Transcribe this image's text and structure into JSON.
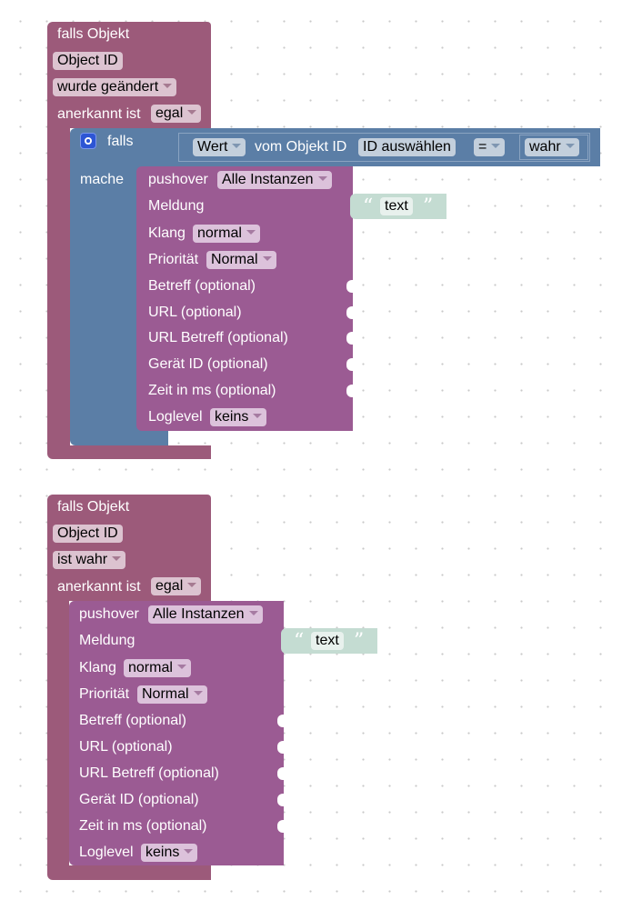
{
  "blocks": [
    {
      "trigger": {
        "title": "falls Objekt",
        "object_id": "Object ID",
        "mode": "wurde geändert",
        "ack_label": "anerkannt ist",
        "ack_value": "egal"
      },
      "if_block": {
        "icon": "gear-icon",
        "if_label": "falls",
        "do_label": "mache",
        "condition": {
          "value_dropdown": "Wert",
          "of_object_label": "vom Objekt ID",
          "object_select": "ID auswählen",
          "operator": "=",
          "compare_value": "wahr"
        }
      },
      "pushover": {
        "label": "pushover",
        "instance": "Alle Instanzen",
        "message_label": "Meldung",
        "message_text": "text",
        "sound_label": "Klang",
        "sound_value": "normal",
        "priority_label": "Priorität",
        "priority_value": "Normal",
        "subject_label": "Betreff (optional)",
        "url_label": "URL (optional)",
        "url_title_label": "URL Betreff (optional)",
        "device_label": "Gerät ID (optional)",
        "time_label": "Zeit in ms (optional)",
        "loglevel_label": "Loglevel",
        "loglevel_value": "keins"
      }
    },
    {
      "trigger": {
        "title": "falls Objekt",
        "object_id": "Object ID",
        "mode": "ist wahr",
        "ack_label": "anerkannt ist",
        "ack_value": "egal"
      },
      "pushover": {
        "label": "pushover",
        "instance": "Alle Instanzen",
        "message_label": "Meldung",
        "message_text": "text",
        "sound_label": "Klang",
        "sound_value": "normal",
        "priority_label": "Priorität",
        "priority_value": "Normal",
        "subject_label": "Betreff (optional)",
        "url_label": "URL (optional)",
        "url_title_label": "URL Betreff (optional)",
        "device_label": "Gerät ID (optional)",
        "time_label": "Zeit in ms (optional)",
        "loglevel_label": "Loglevel",
        "loglevel_value": "keins"
      }
    }
  ],
  "quotes": {
    "open": "“",
    "close": "”"
  },
  "colors": {
    "trigger": "#9c5a7a",
    "if_block": "#5b7ea6",
    "pushover": "#9b5b93",
    "text_literal": "#c4dcd2"
  }
}
